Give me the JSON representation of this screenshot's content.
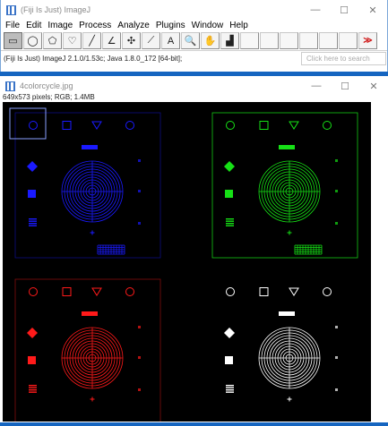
{
  "imagej": {
    "title": "(Fiji Is Just) ImageJ",
    "menu": [
      "File",
      "Edit",
      "Image",
      "Process",
      "Analyze",
      "Plugins",
      "Window",
      "Help"
    ],
    "tools": [
      {
        "name": "rectangle-tool-icon",
        "glyph": "▭",
        "selected": true
      },
      {
        "name": "oval-tool-icon",
        "glyph": "◯"
      },
      {
        "name": "polygon-tool-icon",
        "glyph": "⬠"
      },
      {
        "name": "freehand-tool-icon",
        "glyph": "♡"
      },
      {
        "name": "line-tool-icon",
        "glyph": "╱"
      },
      {
        "name": "angle-tool-icon",
        "glyph": "∠"
      },
      {
        "name": "point-tool-icon",
        "glyph": "✣"
      },
      {
        "name": "wand-tool-icon",
        "glyph": "⟋"
      },
      {
        "name": "text-tool-icon",
        "glyph": "A"
      },
      {
        "name": "magnifier-tool-icon",
        "glyph": "🔍"
      },
      {
        "name": "hand-tool-icon",
        "glyph": "✋"
      },
      {
        "name": "dropper-tool-icon",
        "glyph": "▟"
      },
      {
        "name": "custom-tool-1",
        "glyph": ""
      },
      {
        "name": "custom-tool-2",
        "glyph": ""
      },
      {
        "name": "custom-tool-3",
        "glyph": ""
      },
      {
        "name": "custom-tool-4",
        "glyph": ""
      },
      {
        "name": "custom-tool-5",
        "glyph": ""
      },
      {
        "name": "custom-tool-6",
        "glyph": ""
      },
      {
        "name": "more-tools-arrow-icon",
        "glyph": "≫"
      }
    ],
    "status": "(Fiji Is Just) ImageJ 2.1.0/1.53c; Java 1.8.0_172 [64-bit];",
    "search_placeholder": "Click here to search"
  },
  "image_window": {
    "title": "4colorcycle.jpg",
    "info": "649x573 pixels; RGB; 1.4MB",
    "colors": {
      "blue": "#1a1aff",
      "green": "#16e016",
      "red": "#ff1a1a",
      "white": "#ffffff"
    }
  },
  "window_controls": {
    "minimize": "—",
    "maximize": "☐",
    "close": "✕"
  }
}
